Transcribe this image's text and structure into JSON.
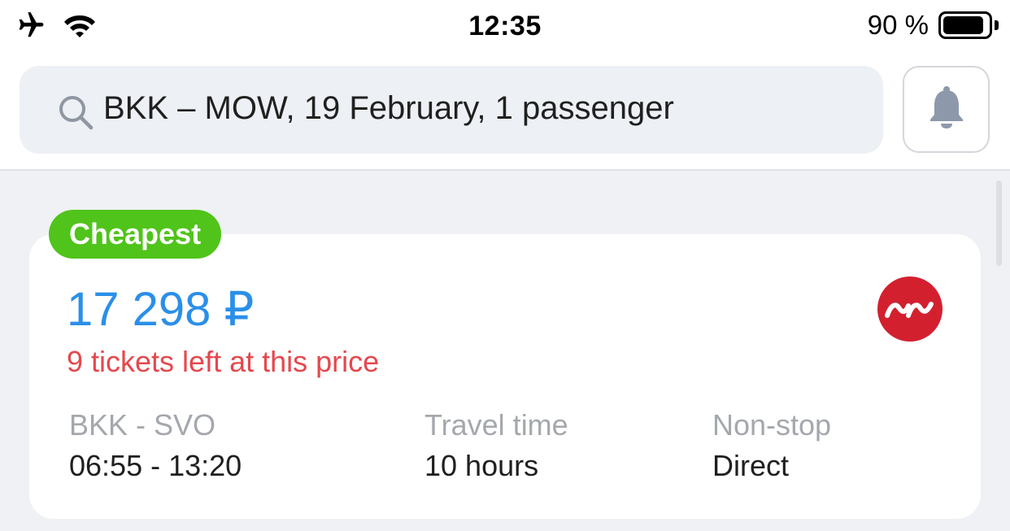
{
  "status_bar": {
    "time": "12:35",
    "battery_percent_text": "90 %",
    "battery_level": 0.9,
    "icons": [
      "airplane-icon",
      "wifi-icon",
      "battery-icon"
    ]
  },
  "search": {
    "query": "BKK – MOW, 19 February, 1 passenger",
    "icons": [
      "search-icon",
      "bell-icon"
    ]
  },
  "result_card": {
    "badge": "Cheapest",
    "price": "17 298 ₽",
    "tickets_left": "9 tickets left at this price",
    "airline_logo_icon": "airline-logo-icon",
    "route": {
      "label": "BKK - SVO",
      "value": "06:55 - 13:20"
    },
    "travel_time": {
      "label": "Travel time",
      "value": "10 hours"
    },
    "stops": {
      "label": "Non-stop",
      "value": "Direct"
    }
  },
  "colors": {
    "price": "#2b8fe8",
    "badge_bg": "#50c41a",
    "warning": "#e5484d",
    "airline_logo_bg": "#d3202f",
    "content_bg": "#eff1f4",
    "search_bg": "#edf0f4"
  }
}
